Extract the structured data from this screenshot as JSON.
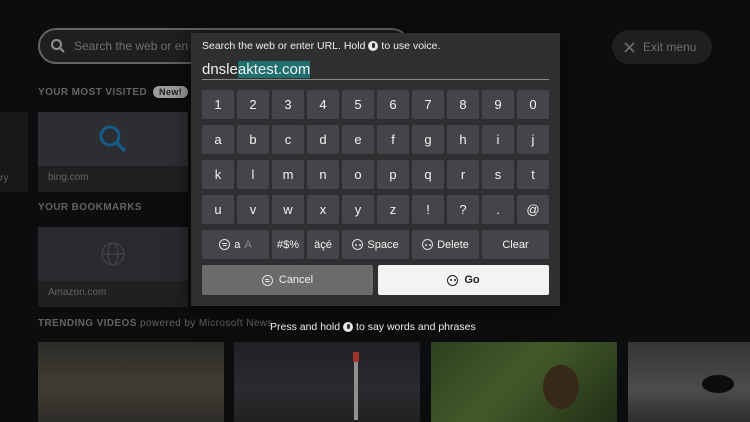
{
  "background": {
    "search_placeholder": "Search the web or en",
    "exit_label": "Exit menu",
    "most_visited_label": "YOUR MOST VISITED",
    "new_badge": "New!",
    "bing_caption": "bing.com",
    "side_caption": "ry",
    "bookmarks_label": "YOUR BOOKMARKS",
    "amazon_caption": "Amazon.com",
    "trending_label": "TRENDING VIDEOS",
    "trending_sub": "powered by Microsoft News"
  },
  "keyboard": {
    "hint_before": "Search the web or enter URL. Hold",
    "hint_after": "to use voice.",
    "typed": "dnsle",
    "suggested": "aktest.com",
    "rows": [
      [
        "1",
        "2",
        "3",
        "4",
        "5",
        "6",
        "7",
        "8",
        "9",
        "0"
      ],
      [
        "a",
        "b",
        "c",
        "d",
        "e",
        "f",
        "g",
        "h",
        "i",
        "j"
      ],
      [
        "k",
        "l",
        "m",
        "n",
        "o",
        "p",
        "q",
        "r",
        "s",
        "t"
      ],
      [
        "u",
        "v",
        "w",
        "x",
        "y",
        "z",
        "!",
        "?",
        ".",
        "@"
      ]
    ],
    "case_lower": "a",
    "case_upper": "A",
    "symbols": "#$%",
    "accents": "äçé",
    "space": "Space",
    "delete": "Delete",
    "clear": "Clear",
    "cancel": "Cancel",
    "go": "Go"
  },
  "footer_hint_before": "Press and hold",
  "footer_hint_after": "to say words and phrases",
  "colors": {
    "suggestion_highlight": "#1f6f6e",
    "overlay": "#2e2f31",
    "key": "#444548"
  }
}
